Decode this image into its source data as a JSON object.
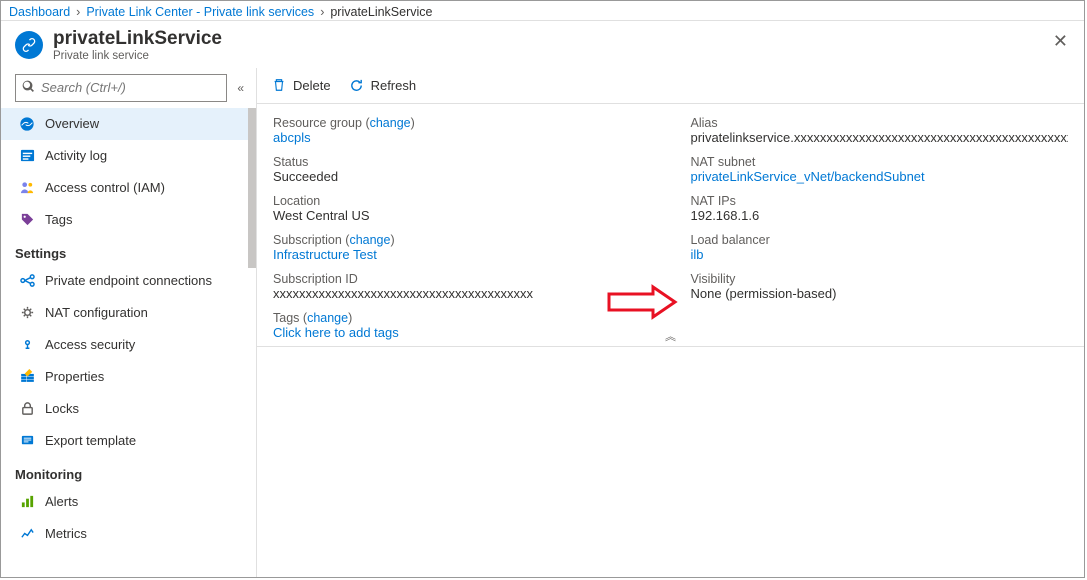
{
  "breadcrumb": {
    "dashboard": "Dashboard",
    "center": "Private Link Center - Private link services",
    "current": "privateLinkService"
  },
  "header": {
    "title": "privateLinkService",
    "subtitle": "Private link service"
  },
  "search": {
    "placeholder": "Search (Ctrl+/)"
  },
  "nav": {
    "overview": "Overview",
    "activity": "Activity log",
    "iam": "Access control (IAM)",
    "tags": "Tags",
    "section_settings": "Settings",
    "pec": "Private endpoint connections",
    "nat": "NAT configuration",
    "accsec": "Access security",
    "props": "Properties",
    "locks": "Locks",
    "export": "Export template",
    "section_monitoring": "Monitoring",
    "alerts": "Alerts",
    "metrics": "Metrics"
  },
  "toolbar": {
    "delete": "Delete",
    "refresh": "Refresh"
  },
  "essentials": {
    "left": {
      "rg_label": "Resource group",
      "rg_change": "change",
      "rg_value": "abcpls",
      "status_label": "Status",
      "status_value": "Succeeded",
      "loc_label": "Location",
      "loc_value": "West Central US",
      "sub_label": "Subscription",
      "sub_change": "change",
      "sub_value": "Infrastructure Test",
      "subid_label": "Subscription ID",
      "subid_value": "xxxxxxxxxxxxxxxxxxxxxxxxxxxxxxxxxxxxxxxx",
      "tags_label": "Tags",
      "tags_change": "change",
      "tags_value": "Click here to add tags"
    },
    "right": {
      "alias_label": "Alias",
      "alias_value": "privatelinkservice.xxxxxxxxxxxxxxxxxxxxxxxxxxxxxxxxxxxxxxxxxxxx",
      "natsub_label": "NAT subnet",
      "natsub_value": "privateLinkService_vNet/backendSubnet",
      "natip_label": "NAT IPs",
      "natip_value": "192.168.1.6",
      "lb_label": "Load balancer",
      "lb_value": "ilb",
      "vis_label": "Visibility",
      "vis_value": "None (permission-based)"
    }
  }
}
